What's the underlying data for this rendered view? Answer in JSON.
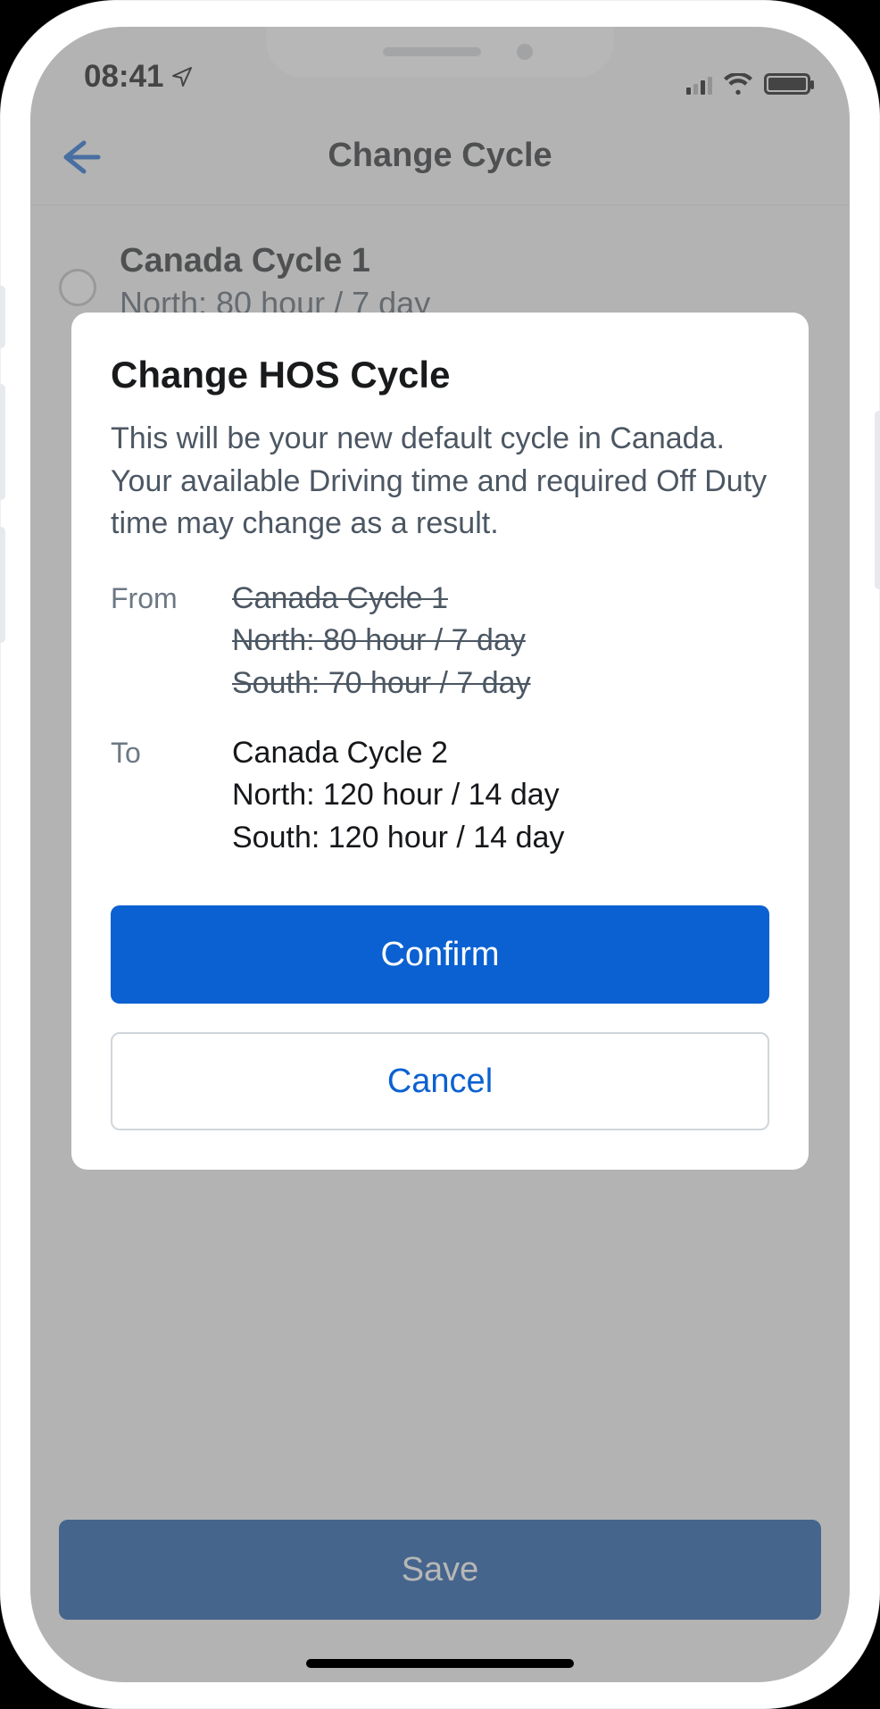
{
  "status": {
    "time": "08:41"
  },
  "nav": {
    "title": "Change Cycle"
  },
  "option": {
    "title": "Canada Cycle 1",
    "subtitle": "North: 80 hour / 7 day"
  },
  "modal": {
    "title": "Change HOS Cycle",
    "body": "This will be your new default cycle in Canada. Your available Driving time and required Off Duty time may change as a result.",
    "from_label": "From",
    "to_label": "To",
    "from": {
      "l1": "Canada Cycle 1",
      "l2": "North: 80 hour / 7 day",
      "l3": "South: 70 hour / 7 day"
    },
    "to": {
      "l1": "Canada Cycle 2",
      "l2": "North: 120 hour / 14 day",
      "l3": "South: 120 hour / 14 day"
    },
    "confirm": "Confirm",
    "cancel": "Cancel"
  },
  "save_label": "Save"
}
